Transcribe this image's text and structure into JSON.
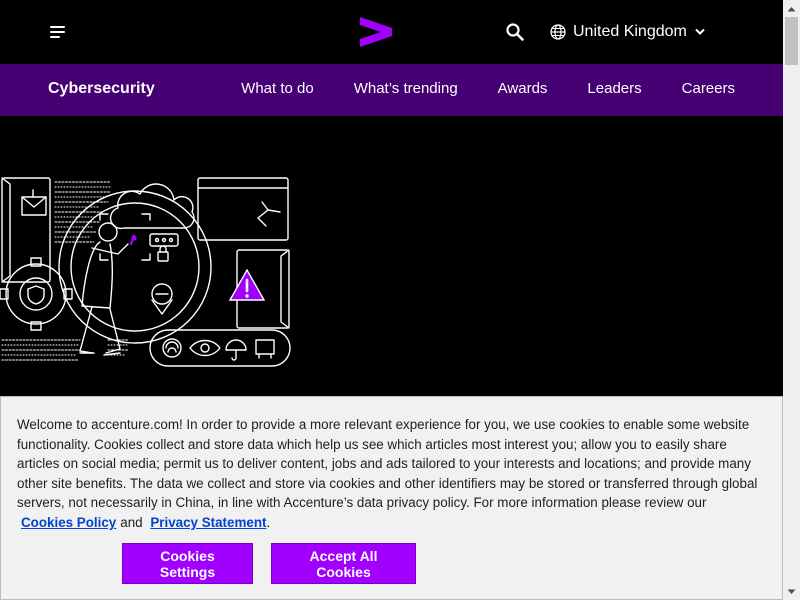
{
  "header": {
    "menu_icon": "hamburger-menu-icon",
    "logo_icon": "accenture-greater-than-logo",
    "search_icon": "search-icon",
    "locale": {
      "icon": "globe-icon",
      "label": "United Kingdom",
      "chevron": "chevron-down-icon"
    }
  },
  "subnav": {
    "title": "Cybersecurity",
    "links": [
      "What to do",
      "What’s trending",
      "Awards",
      "Leaders",
      "Careers"
    ]
  },
  "hero": {
    "illustration": "cybersecurity-line-illustration"
  },
  "cookie_banner": {
    "text_before": "Welcome to accenture.com! In order to provide a more relevant experience for you, we use cookies to enable some website functionality. Cookies collect and store data which help us see which articles most interest you; allow you to easily share articles on social media; permit us to deliver content, jobs and ads tailored to your interests and locations; and provide many other site benefits. The data we collect and store via cookies and other identifiers may be stored or transferred through global servers, not necessarily in China, in line with Accenture’s data privacy policy. For more information please review our",
    "cookies_policy_link": "Cookies Policy",
    "and_text": "and",
    "privacy_link": "Privacy Statement",
    "period": ".",
    "settings_button": "Cookies Settings",
    "accept_button": "Accept All Cookies"
  },
  "colors": {
    "brand_purple": "#a100ff",
    "subnav_purple": "#460073",
    "link_blue": "#0043d1",
    "background": "#000000"
  }
}
